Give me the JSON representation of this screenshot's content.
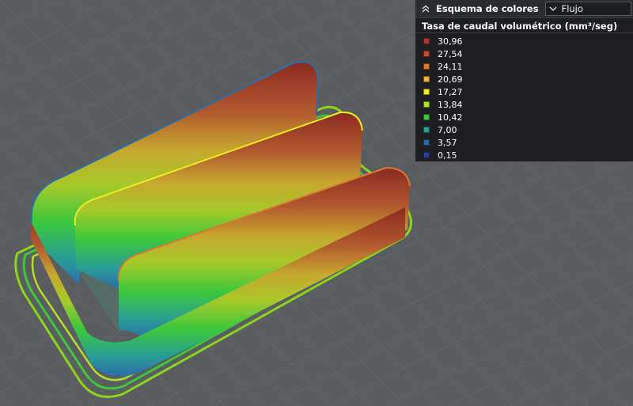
{
  "panel": {
    "title": "Esquema de colores",
    "scheme_value": "Flujo",
    "metric_title": "Tasa de caudal volumétrico (mm³/seg)",
    "legend": [
      {
        "label": "30,96",
        "color": "#a53a2c"
      },
      {
        "label": "27,54",
        "color": "#c84b36"
      },
      {
        "label": "24,11",
        "color": "#d9782e"
      },
      {
        "label": "20,69",
        "color": "#e5b43a"
      },
      {
        "label": "17,27",
        "color": "#ecec22"
      },
      {
        "label": "13,84",
        "color": "#b1e02a"
      },
      {
        "label": "10,42",
        "color": "#3bc83b"
      },
      {
        "label": "7,00",
        "color": "#2a9d97"
      },
      {
        "label": "3,57",
        "color": "#2a6ea8"
      },
      {
        "label": "0,15",
        "color": "#2a3fa0"
      }
    ]
  },
  "icons": {
    "collapse": "double-chevron-up-icon",
    "dropdown": "chevron-down-icon"
  }
}
